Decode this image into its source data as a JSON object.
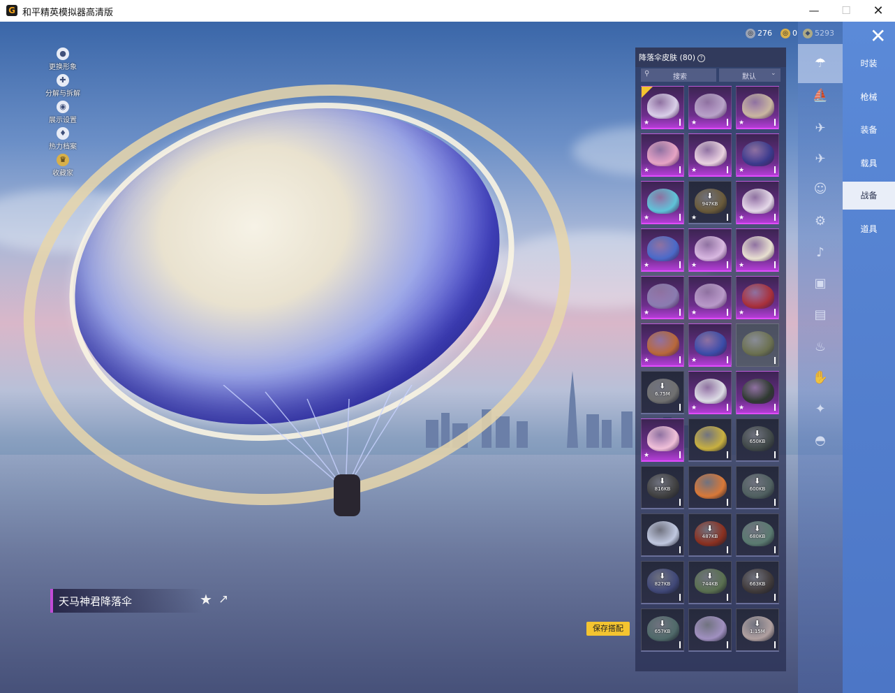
{
  "window": {
    "title": "和平精英模拟器高清版",
    "icon_letter": "G",
    "minimize": "—",
    "maximize": "☐",
    "close": "✕"
  },
  "currencies": [
    {
      "name": "coupon",
      "value": "276",
      "color": "#9aa3b5"
    },
    {
      "name": "token",
      "value": "0",
      "color": "#d8b04a"
    },
    {
      "name": "coin",
      "value": "5293",
      "color": "#f2c94c"
    }
  ],
  "left_menu": [
    {
      "label": "更换形象",
      "icon": "person-icon"
    },
    {
      "label": "分解与拆解",
      "icon": "puzzle-icon"
    },
    {
      "label": "展示设置",
      "icon": "eye-icon"
    },
    {
      "label": "热力档案",
      "icon": "flame-icon"
    },
    {
      "label": "收藏家",
      "icon": "badge-icon"
    }
  ],
  "item": {
    "name": "天马神君降落伞",
    "favorite_icon": "★",
    "share_icon": "↗"
  },
  "save_button": "保存搭配",
  "skin_panel": {
    "title": "降落伞皮肤 (80)",
    "search_placeholder": "搜索",
    "sort_label": "默认",
    "tiles": [
      {
        "style": "purple",
        "color": "#d9cfe8",
        "selected": true
      },
      {
        "style": "purple",
        "color": "#b8a3c8"
      },
      {
        "style": "purple",
        "color": "#c9b6a0"
      },
      {
        "style": "purple",
        "color": "#e6a4c4"
      },
      {
        "style": "purple",
        "color": "#e9d2e0"
      },
      {
        "style": "purple",
        "color": "#3a3a8c"
      },
      {
        "style": "purple",
        "color": "#5fc2d8"
      },
      {
        "style": "dark",
        "color": "#6a5a3a",
        "download": "947KB"
      },
      {
        "style": "purple",
        "color": "#e4d8e8"
      },
      {
        "style": "purple",
        "color": "#4a6ac8"
      },
      {
        "style": "purple",
        "color": "#d8b8e0"
      },
      {
        "style": "purple",
        "color": "#e8e0d0"
      },
      {
        "style": "purple",
        "color": "#8a7cb0"
      },
      {
        "style": "purple",
        "color": "#b89ac8"
      },
      {
        "style": "purple",
        "color": "#a8303a"
      },
      {
        "style": "purple",
        "color": "#b8683a"
      },
      {
        "style": "purple",
        "color": "#3a4ca8"
      },
      {
        "style": "gray",
        "color": "#6b7050"
      },
      {
        "style": "dark",
        "color": "#707070",
        "download": "6.75M"
      },
      {
        "style": "purple",
        "color": "#dcdce4"
      },
      {
        "style": "purple",
        "color": "#2e3a30"
      },
      {
        "style": "purple",
        "color": "#f0c0d8"
      },
      {
        "style": "dark",
        "color": "#c8b040"
      },
      {
        "style": "dark",
        "color": "#404848",
        "download": "650KB"
      },
      {
        "style": "dark",
        "color": "#404040",
        "download": "816KB"
      },
      {
        "style": "dark",
        "color": "#d87838"
      },
      {
        "style": "dark",
        "color": "#506060",
        "download": "600KB"
      },
      {
        "style": "dark",
        "color": "#c0c8e0"
      },
      {
        "style": "dark",
        "color": "#8a3020",
        "download": "487KB"
      },
      {
        "style": "dark",
        "color": "#5a7a70",
        "download": "680KB"
      },
      {
        "style": "dark",
        "color": "#404878",
        "download": "827KB"
      },
      {
        "style": "dark",
        "color": "#5a7050",
        "download": "744KB"
      },
      {
        "style": "dark",
        "color": "#403a3a",
        "download": "663KB"
      },
      {
        "style": "dark",
        "color": "#506a6a",
        "download": "657KB"
      },
      {
        "style": "dark",
        "color": "#a090c0"
      },
      {
        "style": "dark",
        "color": "#b0a0a0",
        "download": "1.15M"
      }
    ]
  },
  "category_icons": [
    "parachute-icon",
    "glider-icon",
    "drone-icon",
    "plane-icon",
    "emote-icon",
    "robot-icon",
    "speaker-icon",
    "frame-icon",
    "picture-icon",
    "extinguisher-icon",
    "hand-icon",
    "wand-icon",
    "hat-icon"
  ],
  "tabs": [
    {
      "label": "时装"
    },
    {
      "label": "枪械"
    },
    {
      "label": "装备"
    },
    {
      "label": "载具"
    },
    {
      "label": "战备",
      "active": true
    },
    {
      "label": "道具"
    }
  ],
  "close_game": "✕"
}
